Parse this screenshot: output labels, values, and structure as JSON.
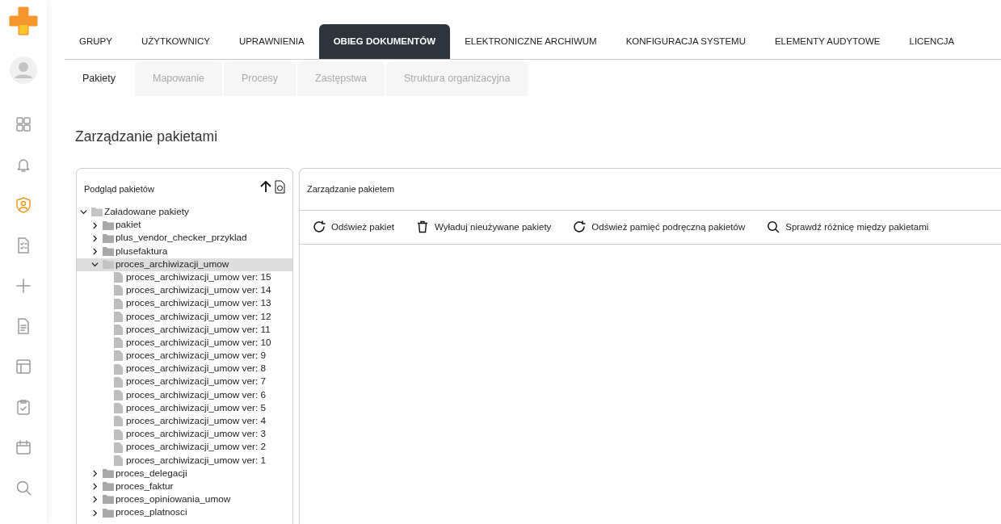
{
  "sidebar": {
    "items": [
      {
        "kind": "grid",
        "selected": false
      },
      {
        "kind": "bell",
        "selected": false
      },
      {
        "kind": "shield",
        "selected": true
      },
      {
        "kind": "checklist",
        "selected": false
      },
      {
        "kind": "plus",
        "selected": false
      },
      {
        "kind": "document",
        "selected": false
      },
      {
        "kind": "layout",
        "selected": false
      },
      {
        "kind": "clipboard",
        "selected": false
      },
      {
        "kind": "calendar",
        "selected": false
      },
      {
        "kind": "search",
        "selected": false
      }
    ]
  },
  "tabs": [
    {
      "label": "GRUPY",
      "selected": false
    },
    {
      "label": "UŻYTKOWNICY",
      "selected": false
    },
    {
      "label": "UPRAWNIENIA",
      "selected": false
    },
    {
      "label": "OBIEG DOKUMENTÓW",
      "selected": true
    },
    {
      "label": "ELEKTRONICZNE ARCHIWUM",
      "selected": false
    },
    {
      "label": "KONFIGURACJA SYSTEMU",
      "selected": false
    },
    {
      "label": "ELEMENTY AUDYTOWE",
      "selected": false
    },
    {
      "label": "LICENCJA",
      "selected": false
    }
  ],
  "subtabs": [
    {
      "label": "Pakiety",
      "selected": true
    },
    {
      "label": "Mapowanie",
      "selected": false
    },
    {
      "label": "Procesy",
      "selected": false
    },
    {
      "label": "Zastępstwa",
      "selected": false
    },
    {
      "label": "Struktura organizacyjna",
      "selected": false
    }
  ],
  "page_title": "Zarządzanie pakietami",
  "tree_panel": {
    "title": "Podgląd pakietów",
    "tree": [
      {
        "label": "Załadowane pakiety",
        "kind": "folder",
        "expanded": true,
        "selected": false,
        "children": [
          {
            "label": "pakiet",
            "kind": "folder",
            "expanded": false,
            "selected": false
          },
          {
            "label": "plus_vendor_checker_przyklad",
            "kind": "folder",
            "expanded": false,
            "selected": false
          },
          {
            "label": "plusefaktura",
            "kind": "folder",
            "expanded": false,
            "selected": false
          },
          {
            "label": "proces_archiwizacji_umow",
            "kind": "folder",
            "expanded": true,
            "selected": true,
            "children": [
              {
                "label": "proces_archiwizacji_umow ver: 15",
                "kind": "file",
                "selected": false
              },
              {
                "label": "proces_archiwizacji_umow ver: 14",
                "kind": "file",
                "selected": false
              },
              {
                "label": "proces_archiwizacji_umow ver: 13",
                "kind": "file",
                "selected": false
              },
              {
                "label": "proces_archiwizacji_umow ver: 12",
                "kind": "file",
                "selected": false
              },
              {
                "label": "proces_archiwizacji_umow ver: 11",
                "kind": "file",
                "selected": false
              },
              {
                "label": "proces_archiwizacji_umow ver: 10",
                "kind": "file",
                "selected": false
              },
              {
                "label": "proces_archiwizacji_umow ver: 9",
                "kind": "file",
                "selected": false
              },
              {
                "label": "proces_archiwizacji_umow ver: 8",
                "kind": "file",
                "selected": false
              },
              {
                "label": "proces_archiwizacji_umow ver: 7",
                "kind": "file",
                "selected": false
              },
              {
                "label": "proces_archiwizacji_umow ver: 6",
                "kind": "file",
                "selected": false
              },
              {
                "label": "proces_archiwizacji_umow ver: 5",
                "kind": "file",
                "selected": false
              },
              {
                "label": "proces_archiwizacji_umow ver: 4",
                "kind": "file",
                "selected": false
              },
              {
                "label": "proces_archiwizacji_umow ver: 3",
                "kind": "file",
                "selected": false
              },
              {
                "label": "proces_archiwizacji_umow ver: 2",
                "kind": "file",
                "selected": false
              },
              {
                "label": "proces_archiwizacji_umow ver: 1",
                "kind": "file",
                "selected": false
              }
            ]
          },
          {
            "label": "proces_delegacji",
            "kind": "folder",
            "expanded": false,
            "selected": false
          },
          {
            "label": "proces_faktur",
            "kind": "folder",
            "expanded": false,
            "selected": false
          },
          {
            "label": "proces_opiniowania_umow",
            "kind": "folder",
            "expanded": false,
            "selected": false
          },
          {
            "label": "proces_platnosci",
            "kind": "folder",
            "expanded": false,
            "selected": false
          }
        ]
      }
    ]
  },
  "manage_panel": {
    "title": "Zarządzanie pakietem",
    "actions": [
      {
        "label": "Odśwież pakiet",
        "kind": "refresh"
      },
      {
        "label": "Wyładuj nieużywane pakiety",
        "kind": "trash"
      },
      {
        "label": "Odśwież pamięć podręczną pakietów",
        "kind": "refresh"
      },
      {
        "label": "Sprawdź różnicę między pakietami",
        "kind": "search"
      }
    ]
  }
}
